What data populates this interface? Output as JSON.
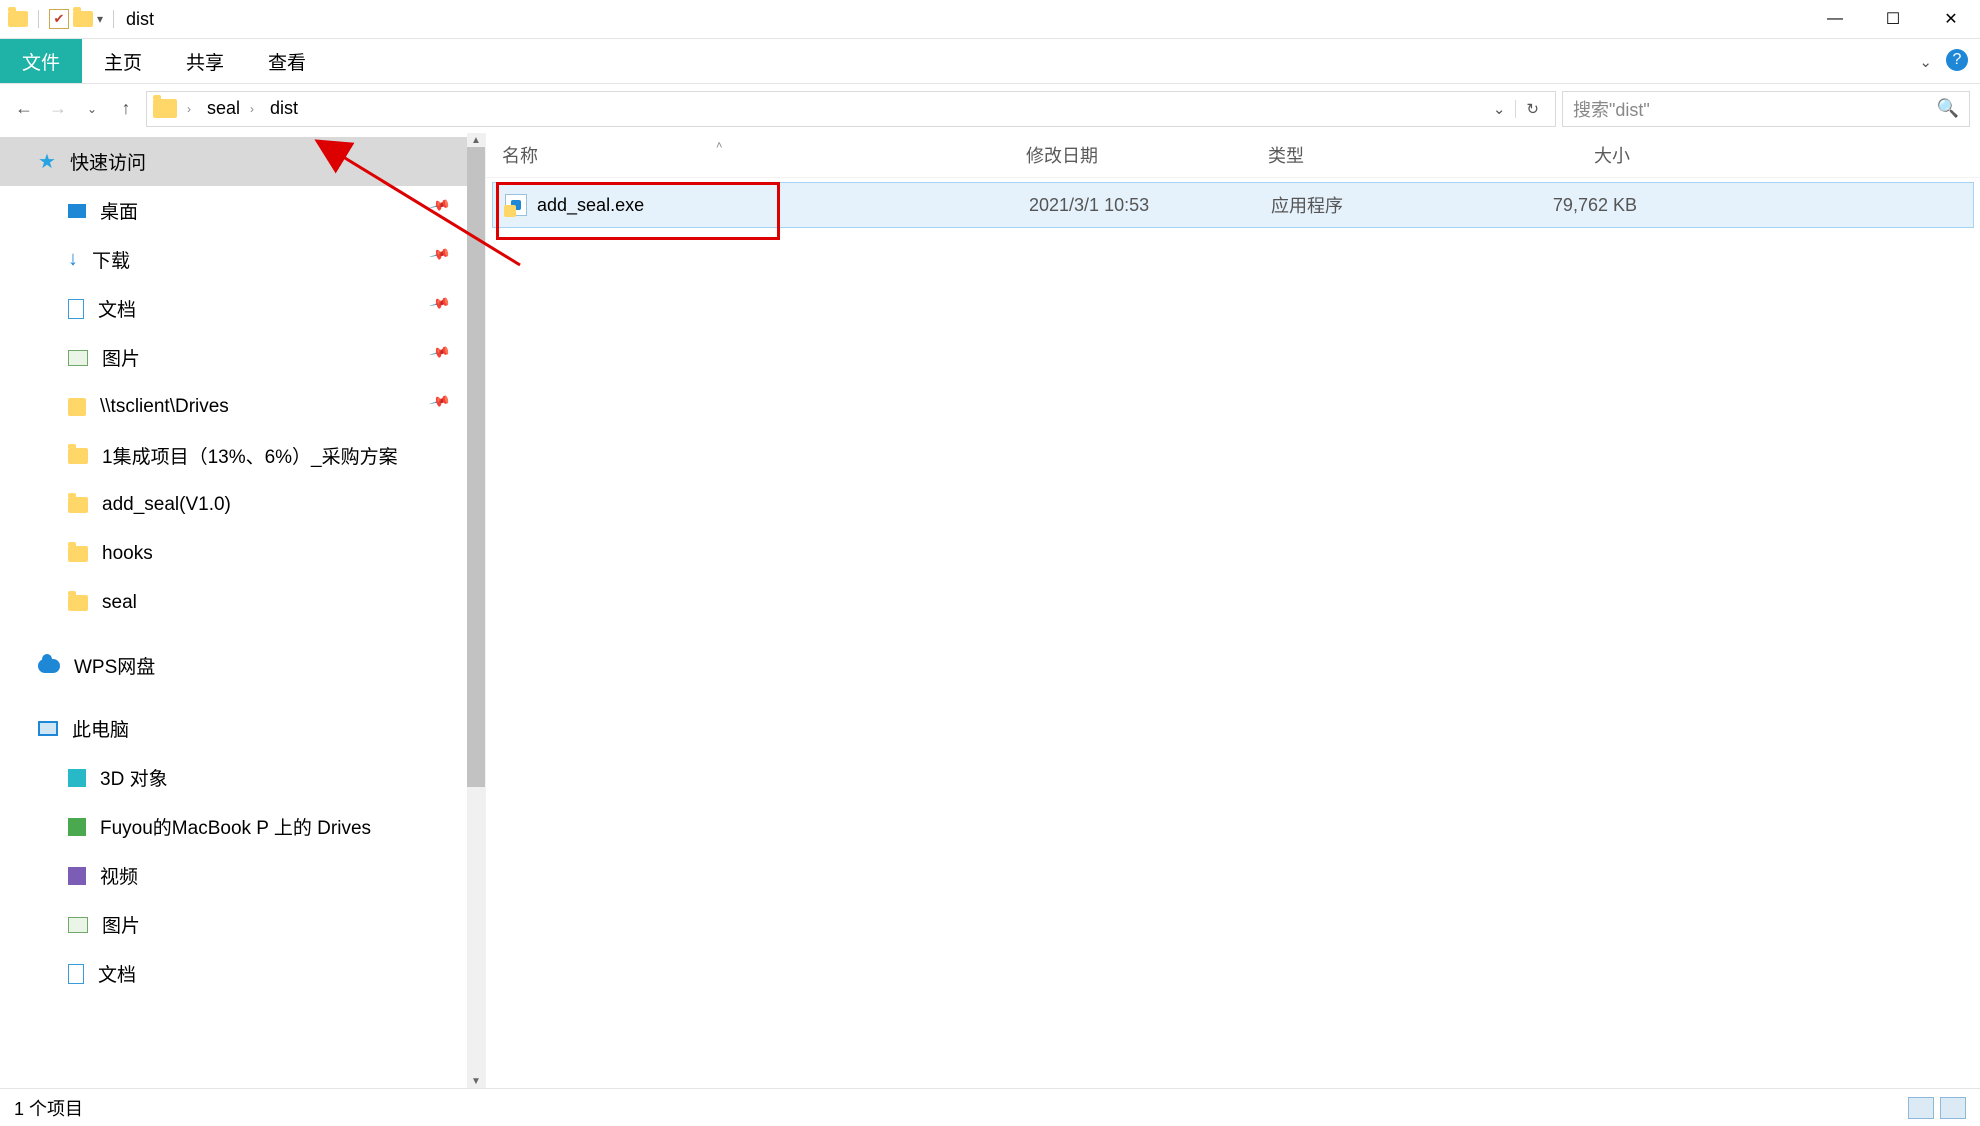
{
  "window": {
    "title": "dist"
  },
  "ribbon": {
    "file": "文件",
    "tabs": [
      "主页",
      "共享",
      "查看"
    ]
  },
  "breadcrumb": {
    "parts": [
      "seal",
      "dist"
    ]
  },
  "search": {
    "placeholder": "搜索\"dist\""
  },
  "columns": {
    "name": "名称",
    "date": "修改日期",
    "type": "类型",
    "size": "大小"
  },
  "files": [
    {
      "name": "add_seal.exe",
      "date": "2021/3/1 10:53",
      "type": "应用程序",
      "size": "79,762 KB"
    }
  ],
  "sidebar": {
    "quick_access": "快速访问",
    "items_pinned": [
      {
        "label": "桌面",
        "icon": "desktop"
      },
      {
        "label": "下载",
        "icon": "download"
      },
      {
        "label": "文档",
        "icon": "doc"
      },
      {
        "label": "图片",
        "icon": "pic"
      },
      {
        "label": "\\\\tsclient\\Drives",
        "icon": "drive"
      }
    ],
    "items_recent": [
      {
        "label": "1集成项目（13%、6%）_采购方案",
        "icon": "folder"
      },
      {
        "label": "add_seal(V1.0)",
        "icon": "folder"
      },
      {
        "label": "hooks",
        "icon": "folder"
      },
      {
        "label": "seal",
        "icon": "folder"
      }
    ],
    "wps": "WPS网盘",
    "this_pc": "此电脑",
    "pc_items": [
      {
        "label": "3D 对象",
        "icon": "3d"
      },
      {
        "label": "Fuyou的MacBook P 上的 Drives",
        "icon": "net"
      },
      {
        "label": "视频",
        "icon": "video"
      },
      {
        "label": "图片",
        "icon": "pic"
      },
      {
        "label": "文档",
        "icon": "doc"
      }
    ]
  },
  "status": {
    "text": "1 个项目"
  }
}
